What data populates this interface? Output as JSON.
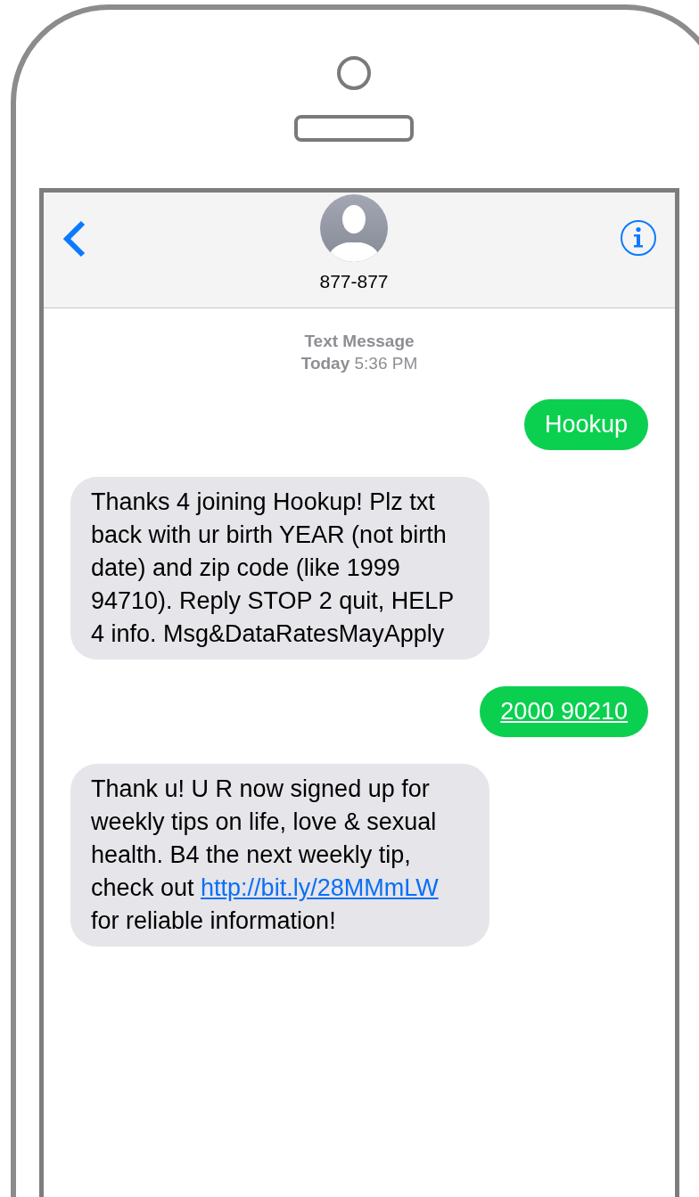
{
  "header": {
    "contact": "877-877"
  },
  "timestamp": {
    "label": "Text Message",
    "time": "**Today** 5:36 PM"
  },
  "messages": [
    {
      "kind": "sent",
      "underlined": false,
      "parts": [
        {
          "text": "Hookup",
          "link": false
        }
      ]
    },
    {
      "kind": "received",
      "underlined": false,
      "parts": [
        {
          "text": "Thanks 4 joining Hookup! Plz txt back with ur birth YEAR (not birth date) and zip code (like 1999 94710). Reply STOP 2 quit, HELP 4 info. Msg&DataRatesMayApply",
          "link": false
        }
      ]
    },
    {
      "kind": "sent",
      "underlined": true,
      "parts": [
        {
          "text": "2000 90210",
          "link": false
        }
      ]
    },
    {
      "kind": "received",
      "underlined": false,
      "parts": [
        {
          "text": "Thank u! U R now signed up for weekly tips on life, love & sexual health. B4 the next weekly tip, check out ",
          "link": false
        },
        {
          "text": "http://bit.ly/28MMmLW",
          "link": true
        },
        {
          "text": " for reliable information!",
          "link": false
        }
      ]
    }
  ]
}
